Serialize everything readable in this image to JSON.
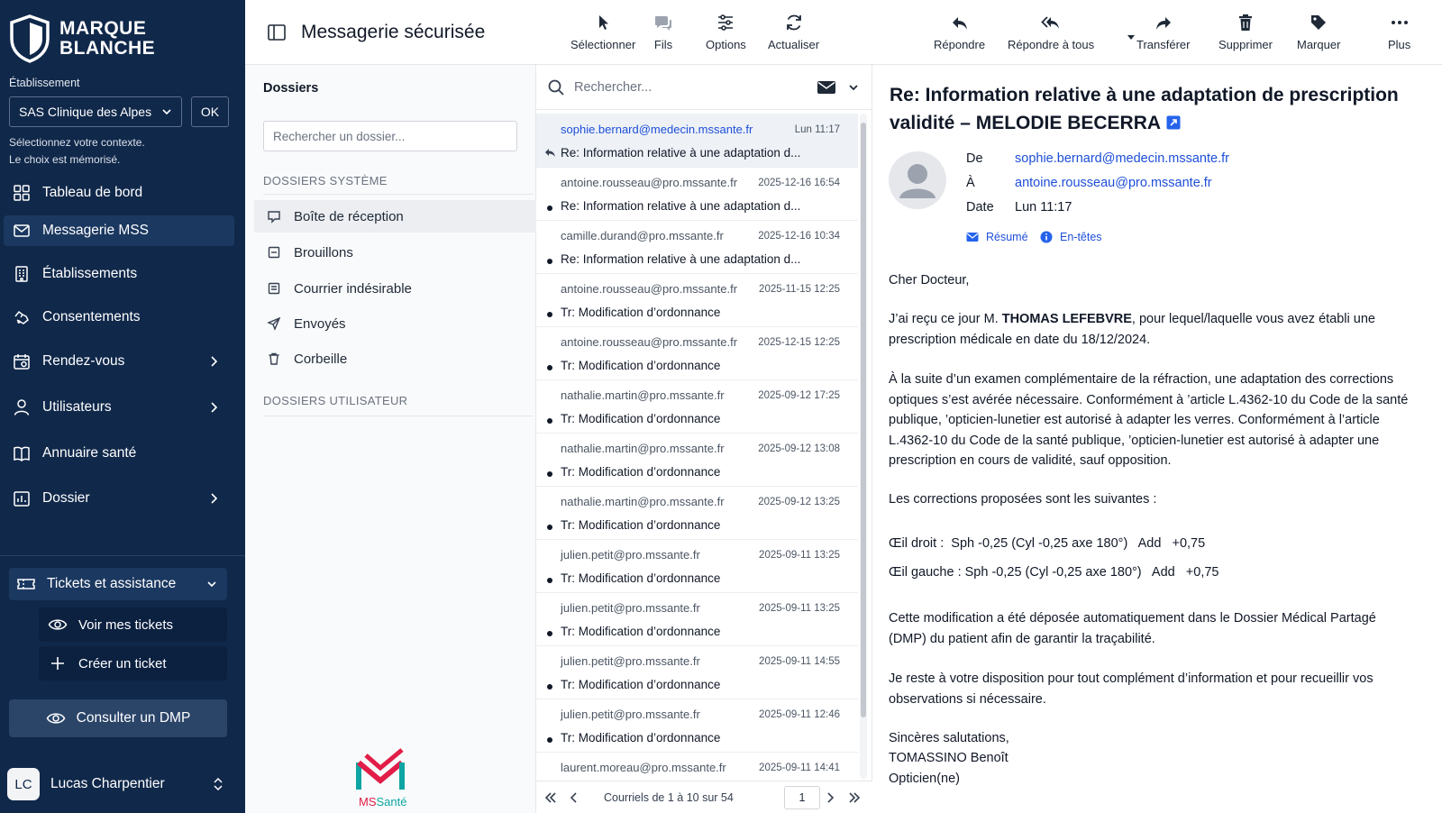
{
  "brand": {
    "line1": "MARQUE",
    "line2": "BLANCHE"
  },
  "establishment": {
    "label": "Établissement",
    "selected": "SAS Clinique des Alpes",
    "ok": "OK",
    "help1": "Sélectionnez votre contexte.",
    "help2": "Le choix est mémorisé."
  },
  "nav": [
    {
      "label": "Tableau de bord",
      "icon": "grid-icon"
    },
    {
      "label": "Messagerie MSS",
      "icon": "mail-icon",
      "active": true
    },
    {
      "label": "Établissements",
      "icon": "building-icon"
    },
    {
      "label": "Consentements",
      "icon": "handshake-icon"
    },
    {
      "label": "Rendez-vous",
      "icon": "calendar-icon",
      "has_submenu": true
    },
    {
      "label": "Utilisateurs",
      "icon": "user-icon",
      "has_submenu": true
    },
    {
      "label": "Annuaire santé",
      "icon": "book-icon"
    },
    {
      "label": "Dossier",
      "icon": "chart-file-icon",
      "has_submenu": true
    }
  ],
  "tickets": {
    "label": "Tickets et assistance",
    "items": [
      "Voir mes tickets",
      "Créer un ticket"
    ]
  },
  "dmp_button": "Consulter un DMP",
  "user": {
    "initials": "LC",
    "name": "Lucas Charpentier"
  },
  "app_title": "Messagerie sécurisée",
  "folders": {
    "title": "Dossiers",
    "search_placeholder": "Rechercher un dossier...",
    "system_title": "DOSSIERS SYSTÈME",
    "system": [
      "Boîte de réception",
      "Brouillons",
      "Courrier indésirable",
      "Envoyés",
      "Corbeille"
    ],
    "user_title": "DOSSIERS UTILISATEUR"
  },
  "ms_brand": {
    "ms": "MS",
    "sante": "Santé"
  },
  "list_toolbar": [
    "Sélectionner",
    "Fils",
    "Options",
    "Actualiser"
  ],
  "list_search_placeholder": "Rechercher...",
  "messages": [
    {
      "from": "sophie.bernard@medecin.mssante.fr",
      "date": "Lun 11:17",
      "subject": "Re: Information relative à une adaptation d...",
      "selected": true,
      "replied": true
    },
    {
      "from": "antoine.rousseau@pro.mssante.fr",
      "date": "2025-12-16 16:54",
      "subject": "Re: Information relative à une adaptation d..."
    },
    {
      "from": "camille.durand@pro.mssante.fr",
      "date": "2025-12-16 10:34",
      "subject": "Re: Information relative à une adaptation d..."
    },
    {
      "from": "antoine.rousseau@pro.mssante.fr",
      "date": "2025-11-15 12:25",
      "subject": "Tr: Modification d’ordonnance"
    },
    {
      "from": "antoine.rousseau@pro.mssante.fr",
      "date": "2025-12-15 12:25",
      "subject": "Tr: Modification d’ordonnance"
    },
    {
      "from": "nathalie.martin@pro.mssante.fr",
      "date": "2025-09-12 17:25",
      "subject": "Tr: Modification d’ordonnance"
    },
    {
      "from": "nathalie.martin@pro.mssante.fr",
      "date": "2025-09-12 13:08",
      "subject": "Tr: Modification d’ordonnance"
    },
    {
      "from": "nathalie.martin@pro.mssante.fr",
      "date": "2025-09-12 13:25",
      "subject": "Tr: Modification d’ordonnance"
    },
    {
      "from": "julien.petit@pro.mssante.fr",
      "date": "2025-09-11 13:25",
      "subject": "Tr: Modification d’ordonnance"
    },
    {
      "from": "julien.petit@pro.mssante.fr",
      "date": "2025-09-11 13:25",
      "subject": "Tr: Modification d’ordonnance"
    },
    {
      "from": "julien.petit@pro.mssante.fr",
      "date": "2025-09-11 14:55",
      "subject": "Tr: Modification d’ordonnance"
    },
    {
      "from": "julien.petit@pro.mssante.fr",
      "date": "2025-09-11 12:46",
      "subject": "Tr: Modification d’ordonnance"
    },
    {
      "from": "laurent.moreau@pro.mssante.fr",
      "date": "2025-09-11 14:41",
      "subject": ""
    }
  ],
  "pager": {
    "text": "Courriels de 1 à 10 sur 54",
    "page": "1"
  },
  "reader_toolbar": [
    "Répondre",
    "Répondre à tous",
    "Transférer",
    "Supprimer",
    "Marquer",
    "Plus"
  ],
  "email": {
    "subject": "Re: Information relative à une adaptation de prescription validité – MELODIE BECERRA",
    "from_label": "De",
    "from": "sophie.bernard@medecin.mssante.fr",
    "to_label": "À",
    "to": "antoine.rousseau@pro.mssante.fr",
    "date_label": "Date",
    "date": "Lun 11:17",
    "summary_link": "Résumé",
    "headers_link": "En-têtes",
    "greeting": "Cher Docteur,",
    "p1_a": "J’ai reçu ce jour M. ",
    "p1_name": "THOMAS LEFEBVRE",
    "p1_b": ", pour lequel/laquelle vous avez établi une prescription médicale en date du 18/12/2024.",
    "p2": "À la suite d’un examen complémentaire de la réfraction, une adaptation des corrections optiques s’est avérée nécessaire. Conformément à ’article L.4362-10 du Code de la santé publique, ’opticien-lunetier est autorisé à adapter les verres. Conformément à l’article L.4362-10 du Code de la santé publique, ’opticien-lunetier est autorisé à adapter une prescription en cours de validité, sauf opposition.",
    "p3": "Les corrections proposées sont les suivantes :",
    "right_eye": "Œil droit :  Sph -0,25 (Cyl -0,25 axe 180°)   Add   +0,75",
    "left_eye": "Œil gauche : Sph -0,25 (Cyl -0,25 axe 180°)   Add   +0,75",
    "p4": "Cette modification a été déposée automatiquement dans le Dossier Médical Partagé (DMP) du patient afin de garantir la traçabilité.",
    "p5": "Je reste à votre disposition pour tout complément d’information et pour recueillir vos observations si nécessaire.",
    "closing": "Sincères salutations,",
    "signature_name": "TOMASSINO Benoît",
    "signature_role": "Opticien(ne)"
  },
  "colors": {
    "sidebar": "#10284a",
    "accent": "#1d4ed8",
    "brand_red": "#e11d48",
    "brand_teal": "#0ea5a4"
  }
}
